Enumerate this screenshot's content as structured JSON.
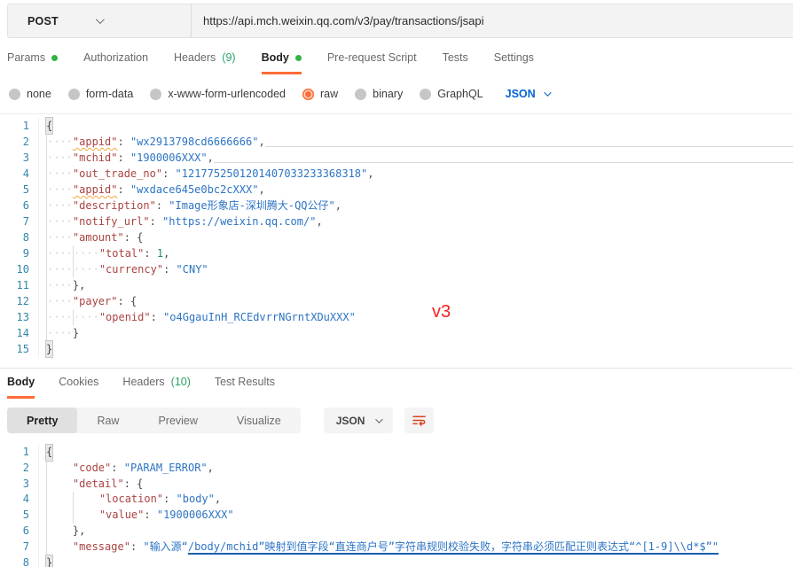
{
  "request": {
    "method": "POST",
    "url": "https://api.mch.weixin.qq.com/v3/pay/transactions/jsapi"
  },
  "request_tabs": {
    "params": "Params",
    "authorization": "Authorization",
    "headers": "Headers",
    "headers_count": "(9)",
    "body": "Body",
    "prerequest": "Pre-request Script",
    "tests": "Tests",
    "settings": "Settings"
  },
  "body_types": {
    "none": "none",
    "form_data": "form-data",
    "urlencoded": "x-www-form-urlencoded",
    "raw": "raw",
    "binary": "binary",
    "graphql": "GraphQL",
    "language": "JSON"
  },
  "annotations": {
    "version_label": "v3"
  },
  "response_tabs": {
    "body": "Body",
    "cookies": "Cookies",
    "headers": "Headers",
    "headers_count": "(10)",
    "test_results": "Test Results"
  },
  "response_toolbar": {
    "pretty": "Pretty",
    "raw": "Raw",
    "preview": "Preview",
    "visualize": "Visualize",
    "language": "JSON"
  },
  "colors": {
    "accent_orange": "#ff6c37",
    "green_dot": "#2fb344",
    "count_green": "#2aa164",
    "link_blue": "#0265d2",
    "code_key": "#a94442",
    "code_string": "#2d74c4",
    "code_number": "#228b57",
    "line_number": "#3186ab",
    "annotation_red": "#fb1f1f",
    "annotation_underline": "#1a5fb0"
  },
  "request_editor": {
    "lines": [
      {
        "n": 1,
        "tokens": [
          {
            "c": "hb",
            "t": "{"
          }
        ]
      },
      {
        "n": 2,
        "rule": true,
        "tokens": [
          {
            "c": "g"
          },
          {
            "c": "w",
            "t": "····"
          },
          {
            "c": "k sq",
            "t": "\"appid\""
          },
          {
            "c": "p",
            "t": ": "
          },
          {
            "c": "s",
            "t": "\"wx2913798cd6666666\""
          },
          {
            "c": "p",
            "t": ","
          }
        ]
      },
      {
        "n": 3,
        "rule": true,
        "tokens": [
          {
            "c": "g"
          },
          {
            "c": "w",
            "t": "····"
          },
          {
            "c": "k",
            "t": "\"mchid\""
          },
          {
            "c": "p",
            "t": ": "
          },
          {
            "c": "s",
            "t": "\"1900006XXX\""
          },
          {
            "c": "p",
            "t": ","
          }
        ]
      },
      {
        "n": 4,
        "tokens": [
          {
            "c": "g"
          },
          {
            "c": "w",
            "t": "····"
          },
          {
            "c": "k",
            "t": "\"out_trade_no\""
          },
          {
            "c": "p",
            "t": ": "
          },
          {
            "c": "s",
            "t": "\"1217752501201407033233368318\""
          },
          {
            "c": "p",
            "t": ","
          }
        ]
      },
      {
        "n": 5,
        "tokens": [
          {
            "c": "g"
          },
          {
            "c": "w",
            "t": "····"
          },
          {
            "c": "k sq",
            "t": "\"appid\""
          },
          {
            "c": "p",
            "t": ": "
          },
          {
            "c": "s",
            "t": "\"wxdace645e0bc2cXXX\""
          },
          {
            "c": "p",
            "t": ","
          }
        ]
      },
      {
        "n": 6,
        "tokens": [
          {
            "c": "g"
          },
          {
            "c": "w",
            "t": "····"
          },
          {
            "c": "k",
            "t": "\"description\""
          },
          {
            "c": "p",
            "t": ": "
          },
          {
            "c": "s",
            "t": "\"Image形象店-深圳腾大-QQ公仔\""
          },
          {
            "c": "p",
            "t": ","
          }
        ]
      },
      {
        "n": 7,
        "tokens": [
          {
            "c": "g"
          },
          {
            "c": "w",
            "t": "····"
          },
          {
            "c": "k",
            "t": "\"notify_url\""
          },
          {
            "c": "p",
            "t": ": "
          },
          {
            "c": "s",
            "t": "\"https://weixin.qq.com/\""
          },
          {
            "c": "p",
            "t": ","
          }
        ]
      },
      {
        "n": 8,
        "tokens": [
          {
            "c": "g"
          },
          {
            "c": "w",
            "t": "····"
          },
          {
            "c": "k",
            "t": "\"amount\""
          },
          {
            "c": "p",
            "t": ": "
          },
          {
            "c": "p",
            "t": "{"
          }
        ]
      },
      {
        "n": 9,
        "tokens": [
          {
            "c": "g"
          },
          {
            "c": "w",
            "t": "····"
          },
          {
            "c": "g"
          },
          {
            "c": "w",
            "t": "····"
          },
          {
            "c": "k",
            "t": "\"total\""
          },
          {
            "c": "p",
            "t": ": "
          },
          {
            "c": "n",
            "t": "1"
          },
          {
            "c": "p",
            "t": ","
          }
        ]
      },
      {
        "n": 10,
        "tokens": [
          {
            "c": "g"
          },
          {
            "c": "w",
            "t": "····"
          },
          {
            "c": "g"
          },
          {
            "c": "w",
            "t": "····"
          },
          {
            "c": "k",
            "t": "\"currency\""
          },
          {
            "c": "p",
            "t": ": "
          },
          {
            "c": "s",
            "t": "\"CNY\""
          }
        ]
      },
      {
        "n": 11,
        "tokens": [
          {
            "c": "g"
          },
          {
            "c": "w",
            "t": "····"
          },
          {
            "c": "p",
            "t": "},"
          }
        ]
      },
      {
        "n": 12,
        "tokens": [
          {
            "c": "g"
          },
          {
            "c": "w",
            "t": "····"
          },
          {
            "c": "k",
            "t": "\"payer\""
          },
          {
            "c": "p",
            "t": ": "
          },
          {
            "c": "p",
            "t": "{"
          }
        ]
      },
      {
        "n": 13,
        "tokens": [
          {
            "c": "g"
          },
          {
            "c": "w",
            "t": "····"
          },
          {
            "c": "g"
          },
          {
            "c": "w",
            "t": "····"
          },
          {
            "c": "k",
            "t": "\"openid\""
          },
          {
            "c": "p",
            "t": ": "
          },
          {
            "c": "s",
            "t": "\"o4GgauInH_RCEdvrrNGrntXDuXXX\""
          }
        ]
      },
      {
        "n": 14,
        "tokens": [
          {
            "c": "g"
          },
          {
            "c": "w",
            "t": "····"
          },
          {
            "c": "p",
            "t": "}"
          }
        ]
      },
      {
        "n": 15,
        "tokens": [
          {
            "c": "hb",
            "t": "}"
          }
        ]
      }
    ]
  },
  "response_editor": {
    "lines": [
      {
        "n": 1,
        "tokens": [
          {
            "c": "hb",
            "t": "{"
          }
        ]
      },
      {
        "n": 2,
        "tokens": [
          {
            "c": "g"
          },
          {
            "c": "p",
            "t": "    "
          },
          {
            "c": "k",
            "t": "\"code\""
          },
          {
            "c": "p",
            "t": ": "
          },
          {
            "c": "s",
            "t": "\"PARAM_ERROR\""
          },
          {
            "c": "p",
            "t": ","
          }
        ]
      },
      {
        "n": 3,
        "tokens": [
          {
            "c": "g"
          },
          {
            "c": "p",
            "t": "    "
          },
          {
            "c": "k",
            "t": "\"detail\""
          },
          {
            "c": "p",
            "t": ": "
          },
          {
            "c": "p",
            "t": "{"
          }
        ]
      },
      {
        "n": 4,
        "tokens": [
          {
            "c": "g"
          },
          {
            "c": "p",
            "t": "    "
          },
          {
            "c": "g"
          },
          {
            "c": "p",
            "t": "    "
          },
          {
            "c": "k",
            "t": "\"location\""
          },
          {
            "c": "p",
            "t": ": "
          },
          {
            "c": "s",
            "t": "\"body\""
          },
          {
            "c": "p",
            "t": ","
          }
        ]
      },
      {
        "n": 5,
        "tokens": [
          {
            "c": "g"
          },
          {
            "c": "p",
            "t": "    "
          },
          {
            "c": "g"
          },
          {
            "c": "p",
            "t": "    "
          },
          {
            "c": "k",
            "t": "\"value\""
          },
          {
            "c": "p",
            "t": ": "
          },
          {
            "c": "s",
            "t": "\"1900006XXX\""
          }
        ]
      },
      {
        "n": 6,
        "tokens": [
          {
            "c": "g"
          },
          {
            "c": "p",
            "t": "    "
          },
          {
            "c": "p",
            "t": "},"
          }
        ]
      },
      {
        "n": 7,
        "tokens": [
          {
            "c": "g"
          },
          {
            "c": "p",
            "t": "    "
          },
          {
            "c": "k",
            "t": "\"message\""
          },
          {
            "c": "p",
            "t": ": "
          },
          {
            "c": "s",
            "t": "\"输入源“"
          },
          {
            "c": "s u",
            "t": "/body/mchid”映射到值字段“直连商户号”字符串规则校验失败，字符串必须匹配正则表达式“^[1-9]\\\\d*$”\""
          }
        ]
      },
      {
        "n": 8,
        "tokens": [
          {
            "c": "hb",
            "t": "}"
          }
        ]
      }
    ]
  }
}
